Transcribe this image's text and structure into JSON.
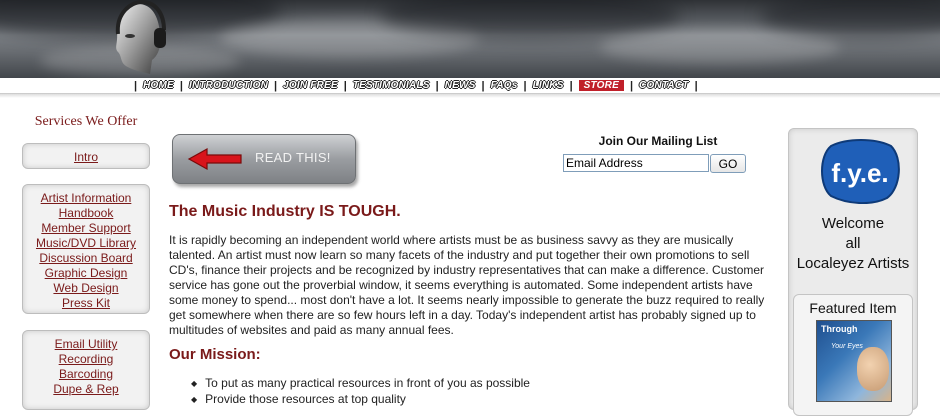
{
  "nav": {
    "items": [
      {
        "label": "HOME"
      },
      {
        "label": "INTRODUCTION"
      },
      {
        "label": "JOIN FREE"
      },
      {
        "label": "TESTIMONIALS"
      },
      {
        "label": "NEWS"
      },
      {
        "label": "FAQs"
      },
      {
        "label": "LINKS"
      },
      {
        "label": "STORE"
      },
      {
        "label": "CONTACT"
      }
    ]
  },
  "sidebar": {
    "title": "Services We Offer",
    "group1": [
      {
        "label": "Intro"
      }
    ],
    "group2": [
      {
        "label": "Artist Information"
      },
      {
        "label": "Handbook"
      },
      {
        "label": "Member Support"
      },
      {
        "label": "Music/DVD Library"
      },
      {
        "label": "Discussion Board"
      },
      {
        "label": "Graphic Design"
      },
      {
        "label": "Web Design"
      },
      {
        "label": "Press Kit"
      }
    ],
    "group3": [
      {
        "label": "Email Utility"
      },
      {
        "label": "Recording"
      },
      {
        "label": "Barcoding"
      },
      {
        "label": "Dupe & Rep"
      }
    ]
  },
  "read_button": {
    "label": "READ THIS!"
  },
  "mailing": {
    "title": "Join Our Mailing List",
    "input_value": "Email Address",
    "go_label": "GO"
  },
  "main": {
    "headline": "The Music Industry IS TOUGH.",
    "body": "It is rapidly becoming an independent world where artists must be as business savvy as they are musically talented. An artist must now learn so many facets of the industry and put together their own promotions to sell CD's, finance their projects and be recognized by industry representatives that can make a difference. Customer service has gone out the proverbial window, it seems everything is automated. Some independent artists have some money to spend... most don't have a lot. It seems nearly impossible to generate the buzz required to really get somewhere when there are so few hours left in a day. Today's independent artist has probably signed up to multitudes of websites and paid as many annual fees.",
    "mission_title": "Our Mission:",
    "mission_items": [
      {
        "text": "To put as many practical resources in front of you as possible"
      },
      {
        "text": "Provide those resources at top quality"
      }
    ]
  },
  "right": {
    "logo_text": "f.y.e.",
    "welcome_lines": [
      "Welcome",
      "all",
      "Localeyez Artists"
    ],
    "featured_title": "Featured Item",
    "album_title": "Through",
    "album_subtitle": "Your Eyes"
  },
  "colors": {
    "accent": "#7a1a1a",
    "store_bg": "#c0202a",
    "fye_blue": "#1f5fb8"
  }
}
